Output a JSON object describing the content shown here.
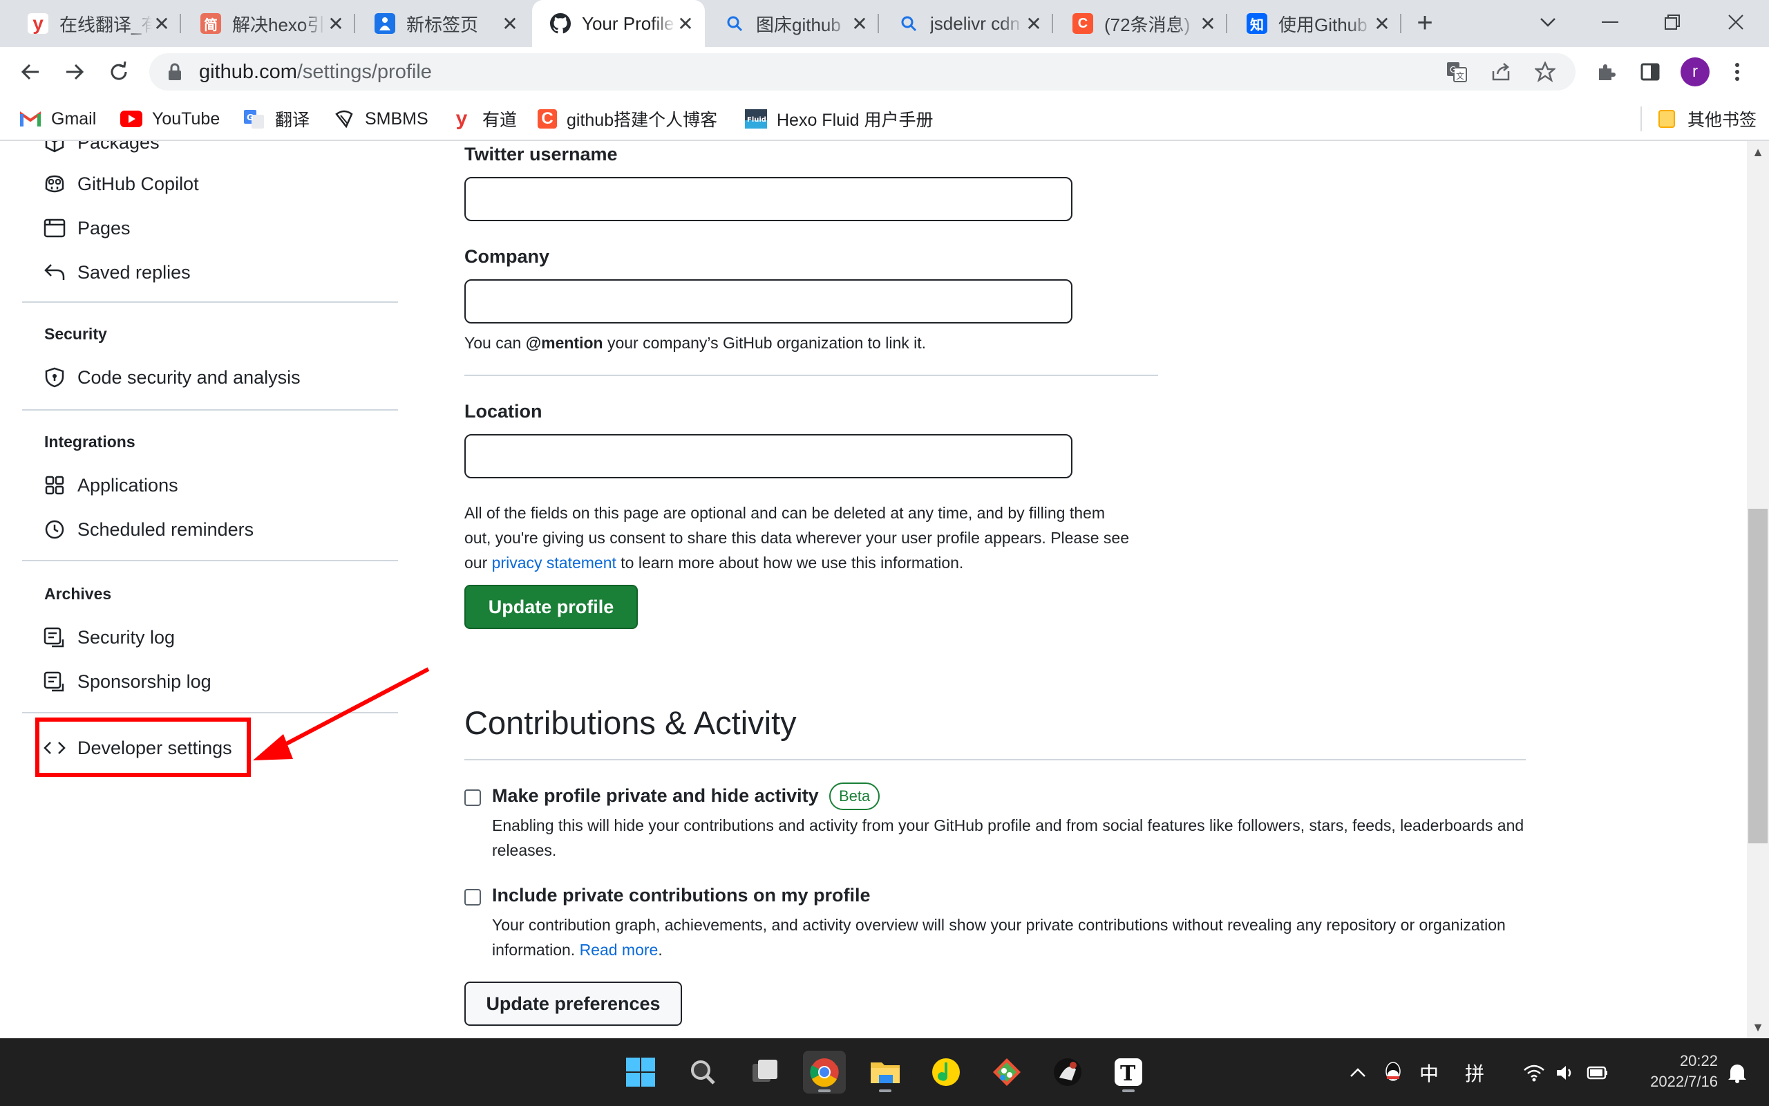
{
  "browser": {
    "tabs": [
      {
        "title": "在线翻译_有道",
        "icon": "youdao-icon",
        "color": "#e53935",
        "glyph": "y"
      },
      {
        "title": "解决hexo引用图片",
        "icon": "jianshu-icon",
        "color": "#ea6f5a",
        "glyph": "简"
      },
      {
        "title": "新标签页",
        "icon": "newtab-icon",
        "color": "#1a73e8",
        "glyph": "人"
      },
      {
        "title": "Your Profile",
        "icon": "github-icon",
        "color": "#24292f",
        "glyph": ""
      },
      {
        "title": "图床github",
        "icon": "search-icon",
        "color": "#1a73e8",
        "glyph": ""
      },
      {
        "title": "jsdelivr cdn",
        "icon": "search-icon",
        "color": "#1a73e8",
        "glyph": ""
      },
      {
        "title": "(72条消息)",
        "icon": "csdn-icon",
        "color": "#fc5531",
        "glyph": "C"
      },
      {
        "title": "使用Github",
        "icon": "zhihu-icon",
        "color": "#0066ff",
        "glyph": "知"
      }
    ],
    "active_tab": 3,
    "url_host": "github.com",
    "url_path": "/settings/profile",
    "profile_initial": "r",
    "bookmarks": [
      {
        "label": "Gmail",
        "icon": "gmail-icon"
      },
      {
        "label": "YouTube",
        "icon": "youtube-icon"
      },
      {
        "label": "翻译",
        "icon": "translate-icon"
      },
      {
        "label": "SMBMS",
        "icon": "smbms-icon"
      },
      {
        "label": "有道",
        "icon": "youdao-icon"
      },
      {
        "label": "github搭建个人博客",
        "icon": "csdn-icon"
      },
      {
        "label": "Hexo Fluid 用户手册",
        "icon": "fluid-icon"
      }
    ],
    "other_bookmarks": "其他书签"
  },
  "sidebar": {
    "top_items": [
      {
        "label": "Packages",
        "icon": "package-icon"
      },
      {
        "label": "GitHub Copilot",
        "icon": "copilot-icon"
      },
      {
        "label": "Pages",
        "icon": "browser-icon"
      },
      {
        "label": "Saved replies",
        "icon": "reply-icon"
      }
    ],
    "security_heading": "Security",
    "security_items": [
      {
        "label": "Code security and analysis",
        "icon": "shield-icon"
      }
    ],
    "integrations_heading": "Integrations",
    "integrations_items": [
      {
        "label": "Applications",
        "icon": "apps-icon"
      },
      {
        "label": "Scheduled reminders",
        "icon": "clock-icon"
      }
    ],
    "archives_heading": "Archives",
    "archives_items": [
      {
        "label": "Security log",
        "icon": "log-icon"
      },
      {
        "label": "Sponsorship log",
        "icon": "log-icon"
      }
    ],
    "developer_settings": "Developer settings"
  },
  "form": {
    "twitter_label": "Twitter username",
    "twitter_value": "",
    "company_label": "Company",
    "company_value": "",
    "company_note_pre": "You can ",
    "company_note_bold": "@mention",
    "company_note_post": " your company’s GitHub organization to link it.",
    "location_label": "Location",
    "location_value": "",
    "privacy_note_1": "All of the fields on this page are optional and can be deleted at any time, and by filling them",
    "privacy_note_2": "out, you're giving us consent to share this data wherever your user profile appears. Please see",
    "privacy_note_3_pre": "our ",
    "privacy_link": "privacy statement",
    "privacy_note_3_post": " to learn more about how we use this information.",
    "update_profile_button": "Update profile"
  },
  "contributions": {
    "title": "Contributions & Activity",
    "private_label": "Make profile private and hide activity",
    "private_checked": false,
    "beta_badge": "Beta",
    "private_desc": "Enabling this will hide your contributions and activity from your GitHub profile and from social features like followers, stars, feeds, leaderboards and releases.",
    "include_label": "Include private contributions on my profile",
    "include_checked": false,
    "include_desc_pre": "Your contribution graph, achievements, and activity overview will show your private contributions without revealing any repository or organization information. ",
    "read_more": "Read more",
    "include_desc_post": ".",
    "update_preferences_button": "Update preferences"
  },
  "taskbar": {
    "apps": [
      "start-icon",
      "search-icon",
      "task-view-icon",
      "chrome-icon",
      "file-explorer-icon",
      "music-icon",
      "git-icon",
      "game-icon",
      "typora-icon"
    ],
    "ime_mode": "中",
    "ime_pinyin": "拼",
    "time": "20:22",
    "date": "2022/7/16"
  },
  "colors": {
    "annotation": "#ff0000",
    "primary_button": "#1a7f37",
    "link": "#0969da"
  }
}
